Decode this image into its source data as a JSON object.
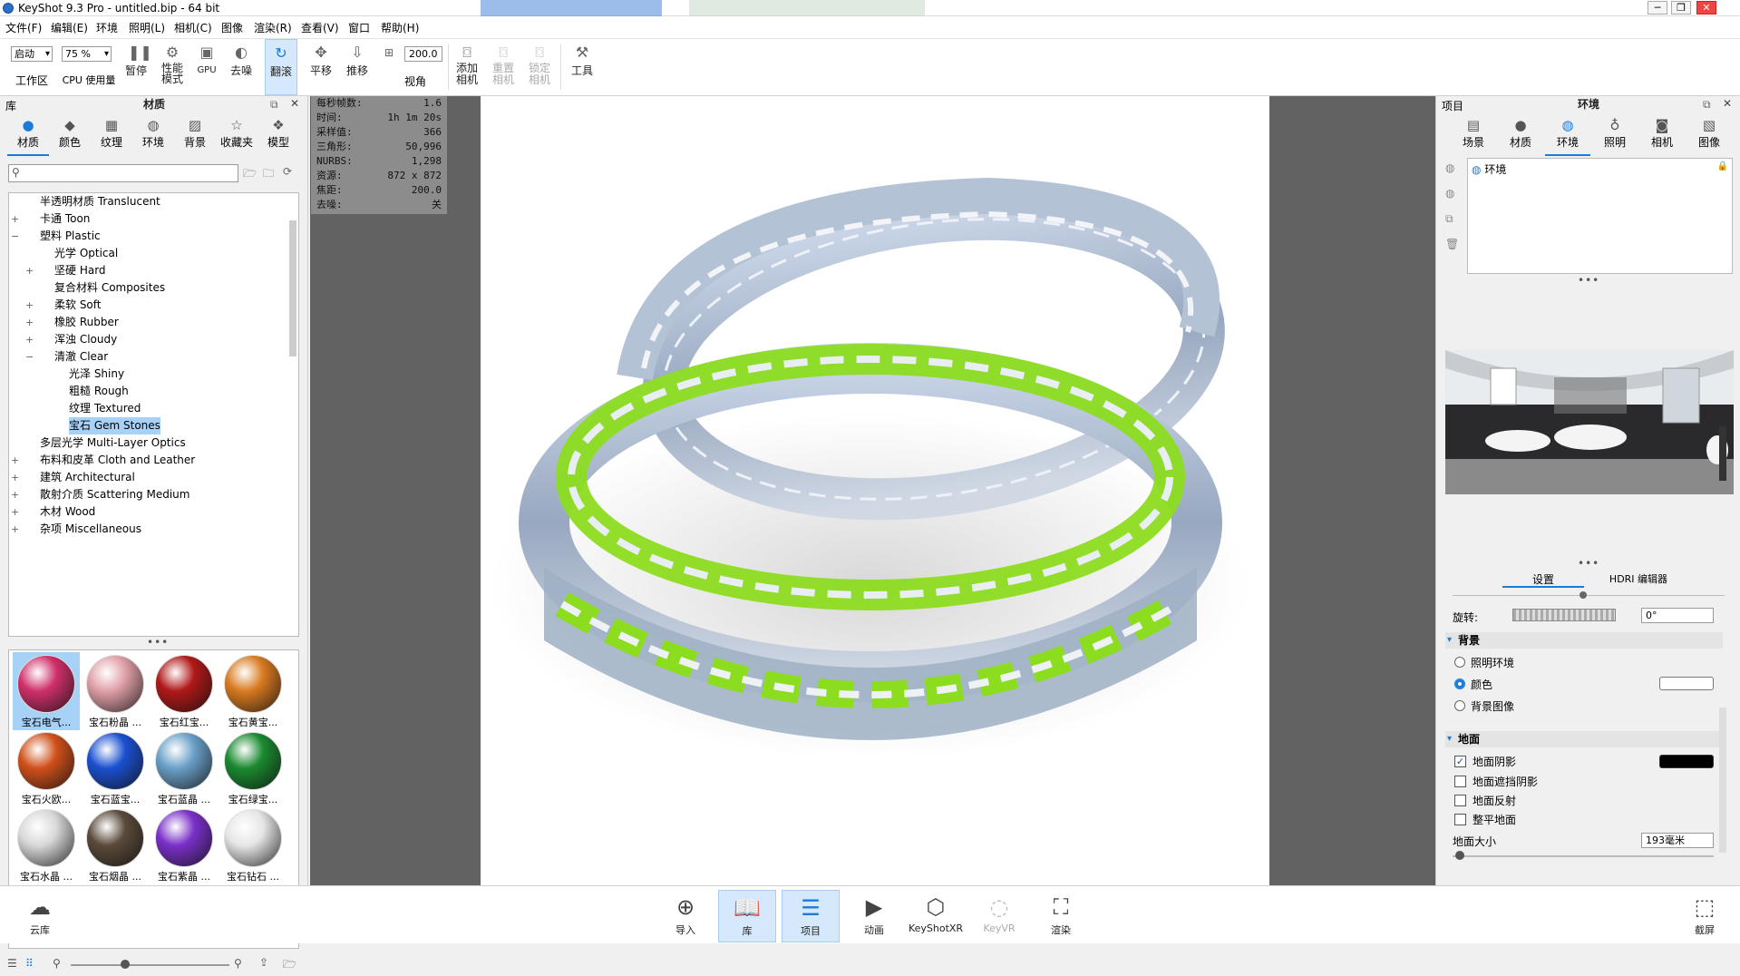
{
  "window": {
    "title": "KeyShot 9.3 Pro  - untitled.bip  - 64 bit",
    "bg_tab_1": "",
    "bg_tab_2": ""
  },
  "menu": [
    "文件(F)",
    "编辑(E)",
    "环境",
    "照明(L)",
    "相机(C)",
    "图像",
    "渲染(R)",
    "查看(V)",
    "窗口",
    "帮助(H)"
  ],
  "toolbar": {
    "workspace_combo": "启动",
    "workspace_label": "工作区",
    "cpu_combo": "75 %",
    "cpu_label": "CPU 使用量",
    "pause_label": "暂停",
    "perf_label_1": "性能",
    "perf_label_2": "模式",
    "gpu_label": "GPU",
    "denoise_label": "去噪",
    "tumble_label": "翻滚",
    "pan_label": "平移",
    "dolly_label": "推移",
    "fov_value": "200.0",
    "fov_label": "视角",
    "add_camera_1": "添加",
    "add_camera_2": "相机",
    "reset_camera_1": "重置",
    "reset_camera_2": "相机",
    "lock_camera_1": "锁定",
    "lock_camera_2": "相机",
    "tools_label": "工具"
  },
  "library": {
    "panel_left_label": "库",
    "panel_title": "材质",
    "tabs": [
      "材质",
      "颜色",
      "纹理",
      "环境",
      "背景",
      "收藏夹",
      "模型"
    ],
    "search_placeholder": "",
    "tree": [
      {
        "label": "半透明材质 Translucent",
        "level": 1,
        "exp": ""
      },
      {
        "label": "卡通 Toon",
        "level": 1,
        "exp": "+"
      },
      {
        "label": "塑料 Plastic",
        "level": 1,
        "exp": "−"
      },
      {
        "label": "光学 Optical",
        "level": 2,
        "exp": ""
      },
      {
        "label": "坚硬 Hard",
        "level": 2,
        "exp": "+"
      },
      {
        "label": "复合材料 Composites",
        "level": 2,
        "exp": ""
      },
      {
        "label": "柔软 Soft",
        "level": 2,
        "exp": "+"
      },
      {
        "label": "橡胶 Rubber",
        "level": 2,
        "exp": "+"
      },
      {
        "label": "浑浊 Cloudy",
        "level": 2,
        "exp": "+"
      },
      {
        "label": "清澈 Clear",
        "level": 2,
        "exp": "−"
      },
      {
        "label": "光泽 Shiny",
        "level": 3,
        "exp": ""
      },
      {
        "label": "粗糙 Rough",
        "level": 3,
        "exp": ""
      },
      {
        "label": "纹理 Textured",
        "level": 3,
        "exp": ""
      },
      {
        "label": "宝石 Gem Stones",
        "level": 3,
        "exp": "",
        "selected": true
      },
      {
        "label": "多层光学 Multi-Layer Optics",
        "level": 1,
        "exp": ""
      },
      {
        "label": "布料和皮革 Cloth and Leather",
        "level": 1,
        "exp": "+"
      },
      {
        "label": "建筑 Architectural",
        "level": 1,
        "exp": "+"
      },
      {
        "label": "散射介质 Scattering Medium",
        "level": 1,
        "exp": "+"
      },
      {
        "label": "木材 Wood",
        "level": 1,
        "exp": "+"
      },
      {
        "label": "杂项 Miscellaneous",
        "level": 1,
        "exp": "+"
      }
    ],
    "thumbnails": [
      {
        "label": "宝石电气...",
        "color": "#d0306a",
        "selected": true
      },
      {
        "label": "宝石粉晶 ...",
        "color": "#e0a0a8"
      },
      {
        "label": "宝石红宝...",
        "color": "#b01818"
      },
      {
        "label": "宝石黄宝...",
        "color": "#d87a20"
      },
      {
        "label": "宝石火欧...",
        "color": "#d0501a"
      },
      {
        "label": "宝石蓝宝...",
        "color": "#1a50d0"
      },
      {
        "label": "宝石蓝晶 ...",
        "color": "#6aa0c8"
      },
      {
        "label": "宝石绿宝...",
        "color": "#1a8a30"
      },
      {
        "label": "宝石水晶 ...",
        "color": "#d8d8d8"
      },
      {
        "label": "宝石烟晶 ...",
        "color": "#5a4a3a"
      },
      {
        "label": "宝石紫晶 ...",
        "color": "#7a30c8"
      },
      {
        "label": "宝石钻石 ...",
        "color": "#e6e6e6"
      }
    ]
  },
  "stats": [
    {
      "k": "每秒帧数:",
      "v": "1.6"
    },
    {
      "k": "时间:",
      "v": "1h 1m 20s"
    },
    {
      "k": "采样值:",
      "v": "366"
    },
    {
      "k": "三角形:",
      "v": "50,996"
    },
    {
      "k": "NURBS:",
      "v": "1,298"
    },
    {
      "k": "资源:",
      "v": "872 x 872"
    },
    {
      "k": "焦距:",
      "v": "200.0"
    },
    {
      "k": "去噪:",
      "v": "关"
    }
  ],
  "project": {
    "panel_left_label": "项目",
    "panel_title": "环境",
    "tabs": [
      "场景",
      "材质",
      "环境",
      "照明",
      "相机",
      "图像"
    ],
    "env_item": "环境",
    "subtabs": [
      "设置",
      "HDRI 编辑器"
    ],
    "rotation_label": "旋转:",
    "rotation_value": "0°",
    "background_section": "背景",
    "bg_options": [
      "照明环境",
      "颜色",
      "背景图像"
    ],
    "ground_section": "地面",
    "ground_options": [
      {
        "label": "地面阴影",
        "checked": true
      },
      {
        "label": "地面遮挡阴影",
        "checked": false
      },
      {
        "label": "地面反射",
        "checked": false
      },
      {
        "label": "整平地面",
        "checked": false
      }
    ],
    "ground_size_label": "地面大小",
    "ground_size_value": "193毫米"
  },
  "bottom": {
    "cloud_label": "云库",
    "buttons": [
      "导入",
      "库",
      "项目",
      "动画",
      "KeyShotXR",
      "KeyVR",
      "渲染"
    ],
    "screenshot_label": "截屏"
  },
  "colors": {
    "accent": "#1c7bd9",
    "viewport_bg": "#626262",
    "ring_green": "#8cdc20"
  }
}
